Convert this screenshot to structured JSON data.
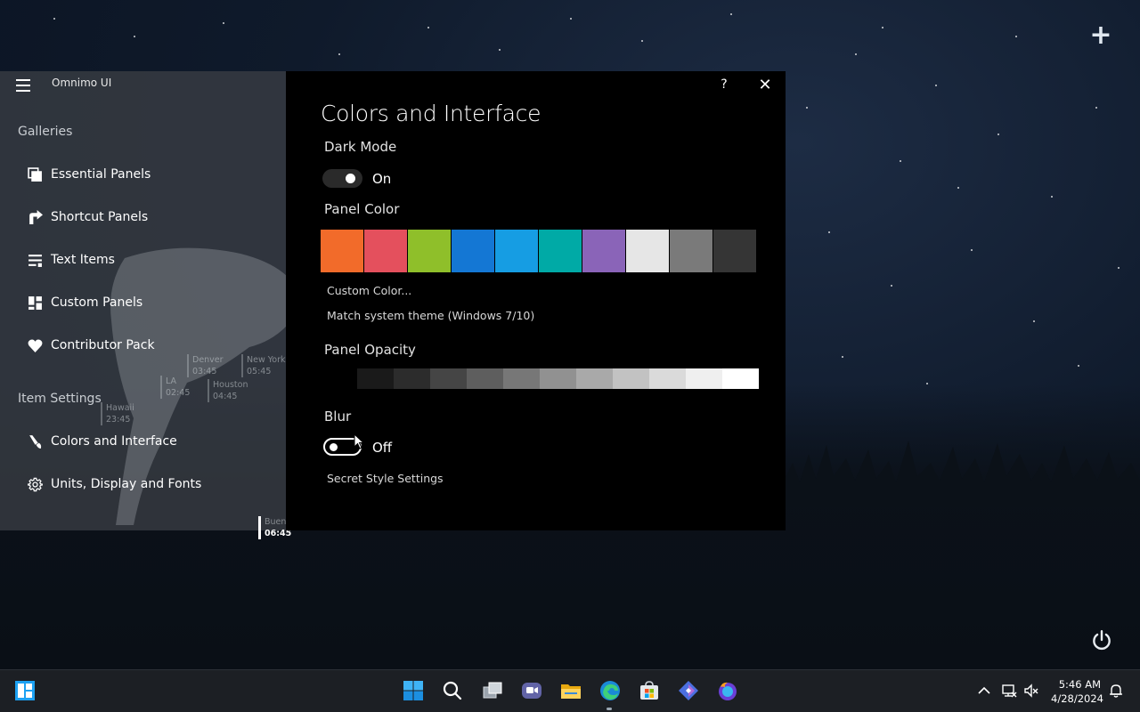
{
  "desktop": {
    "add_icon": "plus-icon",
    "power_icon": "power-icon"
  },
  "sidebar": {
    "app_title": "Omnimo UI",
    "galleries_label": "Galleries",
    "items": [
      {
        "label": "Essential Panels",
        "icon": "panels-icon"
      },
      {
        "label": "Shortcut Panels",
        "icon": "shortcut-icon"
      },
      {
        "label": "Text Items",
        "icon": "text-lines-icon"
      },
      {
        "label": "Custom Panels",
        "icon": "custom-panels-icon"
      },
      {
        "label": "Contributor Pack",
        "icon": "heart-icon"
      }
    ],
    "item_settings_label": "Item Settings",
    "settings_items": [
      {
        "label": "Colors and Interface",
        "icon": "brush-icon"
      },
      {
        "label": "Units, Display and Fonts",
        "icon": "gear-icon"
      }
    ],
    "world_clocks": [
      {
        "city": "Denver",
        "time": "03:45"
      },
      {
        "city": "New York",
        "time": "05:45"
      },
      {
        "city": "LA",
        "time": "02:45"
      },
      {
        "city": "Houston",
        "time": "04:45"
      },
      {
        "city": "Hawaii",
        "time": "23:45"
      },
      {
        "city": "Buenos Aires",
        "time": "06:45"
      }
    ]
  },
  "dialog": {
    "help_label": "?",
    "close_label": "✕",
    "title": "Colors and Interface",
    "dark_mode": {
      "label": "Dark Mode",
      "state": "On"
    },
    "panel_color": {
      "label": "Panel Color",
      "swatches": [
        "#f26b2a",
        "#e4505d",
        "#8fbf2a",
        "#1477d4",
        "#169de3",
        "#00aaa6",
        "#8a64b8",
        "#e6e6e6",
        "#7a7a7a",
        "#353535"
      ],
      "custom_color_label": "Custom Color...",
      "match_system_label": "Match system theme (Windows 7/10)"
    },
    "panel_opacity": {
      "label": "Panel Opacity",
      "steps": [
        "#1a1a1a",
        "#2c2c2c",
        "#454545",
        "#5e5e5e",
        "#777777",
        "#919191",
        "#a9a9a9",
        "#c2c2c2",
        "#dadada",
        "#efefef",
        "#ffffff"
      ]
    },
    "blur": {
      "label": "Blur",
      "state": "Off"
    },
    "secret_style_label": "Secret Style Settings"
  },
  "taskbar": {
    "start_icon": "omnimo-start-icon",
    "center_icons": [
      "windows-start-icon",
      "search-icon",
      "task-view-icon",
      "teams-chat-icon",
      "file-explorer-icon",
      "edge-icon",
      "store-icon",
      "copilot-icon",
      "firefox-icon"
    ],
    "tray": {
      "time": "5:46 AM",
      "date": "4/28/2024"
    }
  }
}
